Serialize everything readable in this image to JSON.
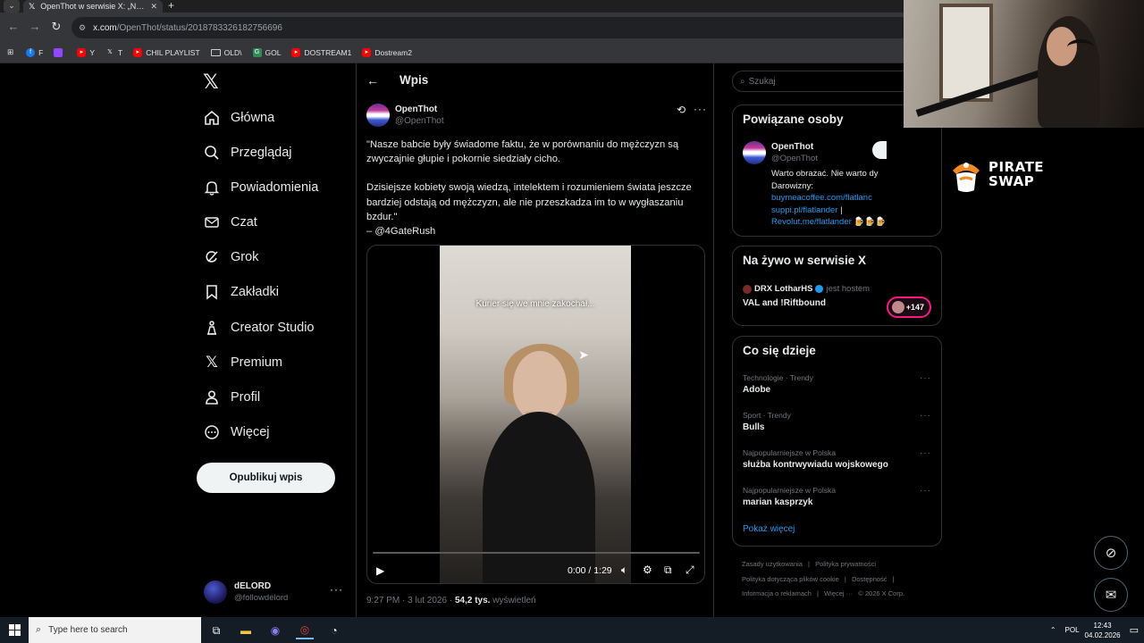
{
  "browser": {
    "tab_title": "OpenThot w serwisie X: „Nasze",
    "url_host": "x.com",
    "url_path": "/OpenThot/status/2018783326182756696",
    "bookmarks": [
      {
        "label": "F",
        "color": "#1877f2"
      },
      {
        "label": "",
        "color": "#9146ff"
      },
      {
        "label": "Y",
        "color": "#ff0000"
      },
      {
        "label": "T",
        "color": "#000000"
      },
      {
        "label": "CHIL PLAYLIST",
        "color": "#ff0000"
      },
      {
        "label": "OLD\\",
        "color": "#e3e3e3"
      },
      {
        "label": "GOL",
        "color": "#2e8b57"
      },
      {
        "label": "DOSTREAM1",
        "color": "#ff0000"
      },
      {
        "label": "Dostream2",
        "color": "#ff0000"
      }
    ]
  },
  "nav": {
    "items": [
      {
        "label": "Główna",
        "icon": "home-icon"
      },
      {
        "label": "Przeglądaj",
        "icon": "search-icon"
      },
      {
        "label": "Powiadomienia",
        "icon": "bell-icon"
      },
      {
        "label": "Czat",
        "icon": "mail-icon"
      },
      {
        "label": "Grok",
        "icon": "grok-icon"
      },
      {
        "label": "Zakładki",
        "icon": "bookmark-icon"
      },
      {
        "label": "Creator Studio",
        "icon": "creator-icon"
      },
      {
        "label": "Premium",
        "icon": "x-icon"
      },
      {
        "label": "Profil",
        "icon": "person-icon"
      },
      {
        "label": "Więcej",
        "icon": "more-circle-icon"
      }
    ],
    "publish": "Opublikuj wpis",
    "account_name": "dELORD",
    "account_handle": "@followdelord"
  },
  "main": {
    "title": "Wpis",
    "post": {
      "name": "OpenThot",
      "handle": "@OpenThot",
      "text_1": "\"Nasze babcie były świadome faktu, że w porównaniu do mężczyzn są zwyczajnie głupie i pokornie siedziały cicho.",
      "text_2": "Dzisiejsze kobiety swoją wiedzą, intelektem i rozumieniem świata jeszcze bardziej odstają od mężczyzn, ale nie przeszkadza im to w wygłaszaniu bzdur.\"",
      "text_3": "– @4GateRush",
      "video_caption": "Kurier się we mnie zakochał...",
      "video_time": "0:00 / 1:29",
      "video_progress": 0.0,
      "meta_time": "9:27 PM · 3 lut 2026 · ",
      "meta_views": "54,2 tys.",
      "meta_views_label": " wyświetleń"
    }
  },
  "sidebar": {
    "search_placeholder": "Szukaj",
    "related_title": "Powiązane osoby",
    "related": {
      "name": "OpenThot",
      "handle": "@OpenThot",
      "bio_1": "Warto obrażać. Nie warto dy",
      "bio_2": "Darowizny:",
      "link_1": "buymeacoffee.com/flatlanc",
      "link_2": "suppi.pl/flatlander",
      "link_2_sep": " |",
      "link_3": "Revolut.me/flatlander",
      "emoji": "🍺🍺🍺"
    },
    "live_title": "Na żywo w serwisie X",
    "live": {
      "host": "DRX LotharHS",
      "host_label": "jest hostem",
      "title": "VAL and !Riftbound",
      "count": "+147"
    },
    "trends_title": "Co się dzieje",
    "trends": [
      {
        "category": "Technologie · Trendy",
        "name": "Adobe"
      },
      {
        "category": "Sport · Trendy",
        "name": "Bulls"
      },
      {
        "category": "Najpopularniejsze w Polska",
        "name": "służba kontrwywiadu wojskowego"
      },
      {
        "category": "Najpopularniejsze w Polska",
        "name": "marian kasprzyk"
      }
    ],
    "show_more": "Pokaż więcej",
    "footer": [
      "Zasady użytkowania",
      "|",
      "Polityka prywatności",
      "|",
      "Polityka dotycząca plików cookie",
      "|",
      "Dostępność",
      "|",
      "Informacja o reklamach",
      "|",
      "Więcej ···",
      "© 2026 X Corp."
    ]
  },
  "overlay": {
    "sponsor_line1": "PIRATE",
    "sponsor_line2": "SWAP"
  },
  "taskbar": {
    "search_placeholder": "Type here to search",
    "lang": "POL",
    "time": "12:43",
    "date": "04.02.2026"
  }
}
